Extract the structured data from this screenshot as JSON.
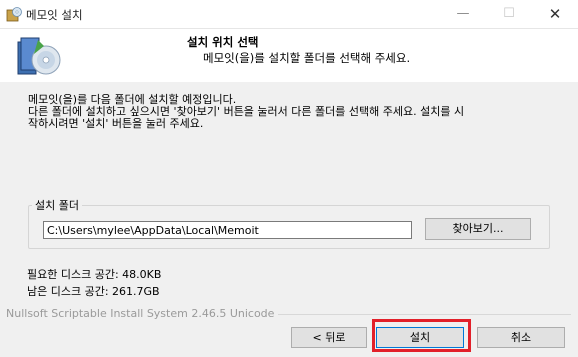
{
  "window": {
    "title": "메모잇 설치",
    "min_glyph": "—",
    "max_glyph": "☐",
    "close_glyph": "✕"
  },
  "header": {
    "title": "설치 위치 선택",
    "subtitle": "메모잇(을)를 설치할 폴더를 선택해 주세요."
  },
  "intro": {
    "line1": "메모잇(을)를 다음 폴더에 설치할 예정입니다.",
    "line2": "다른 폴더에 설치하고 싶으시면 '찾아보기' 버튼을 눌러서 다른 폴더를 선택해 주세요. 설치를 시",
    "line3": "작하시려면 '설치' 버튼을 눌러 주세요."
  },
  "folder": {
    "group_label": "설치 폴더",
    "path_value": "C:\\Users\\mylee\\AppData\\Local\\Memoit",
    "browse_label": "찾아보기..."
  },
  "space": {
    "required": "필요한 디스크 공간: 48.0KB",
    "available": "남은 디스크 공간: 261.7GB"
  },
  "footer": {
    "nsis": "Nullsoft Scriptable Install System 2.46.5 Unicode",
    "back_label": "< 뒤로",
    "install_label": "설치",
    "cancel_label": "취소"
  },
  "colors": {
    "highlight": "#e2202a",
    "focus": "#0078d7"
  },
  "icons": {
    "app": "installer-box-icon",
    "header": "installer-cd-box-icon"
  }
}
